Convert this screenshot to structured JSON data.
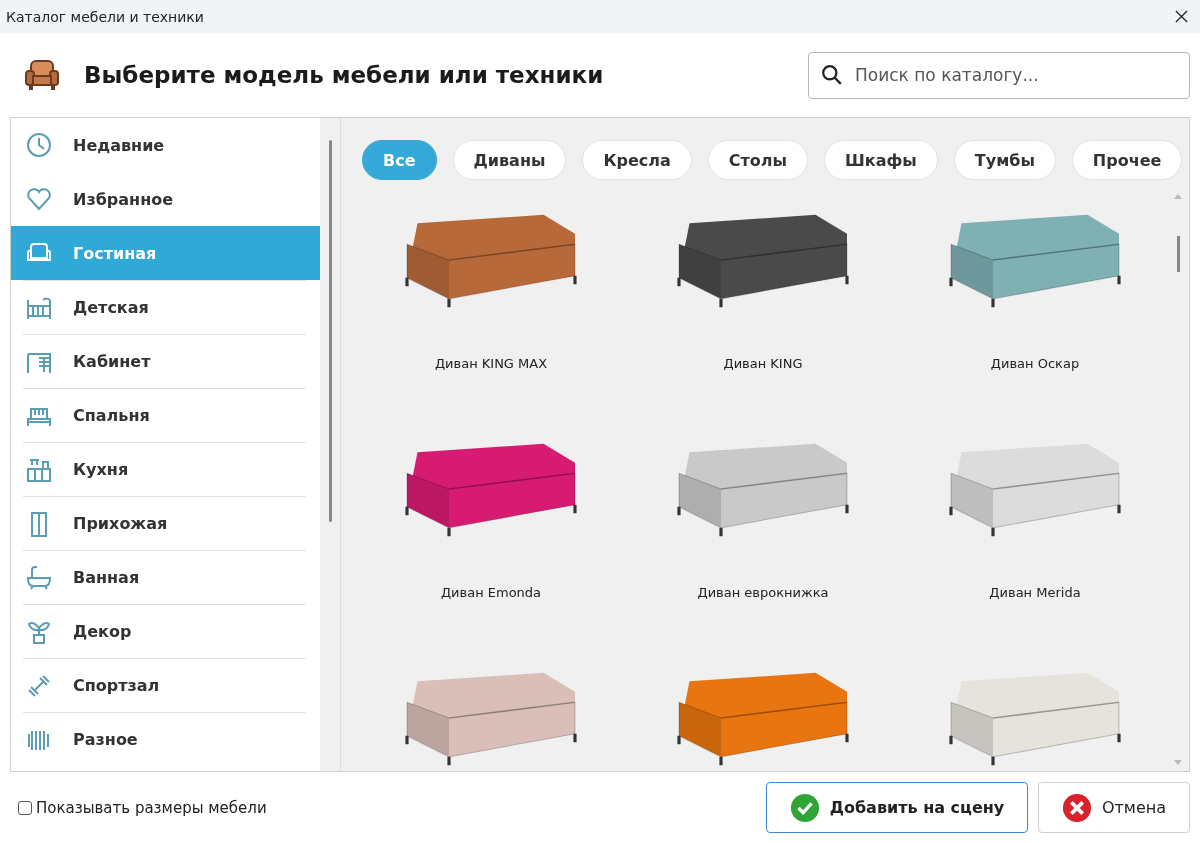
{
  "window": {
    "title": "Каталог мебели и техники"
  },
  "header": {
    "title": "Выберите модель мебели или техники",
    "search": {
      "placeholder": "Поиск по каталогу..."
    }
  },
  "sidebar": {
    "items": [
      {
        "label": "Недавние",
        "selected": false
      },
      {
        "label": "Избранное",
        "selected": false
      },
      {
        "label": "Гостиная",
        "selected": true
      },
      {
        "label": "Детская",
        "selected": false
      },
      {
        "label": "Кабинет",
        "selected": false
      },
      {
        "label": "Спальня",
        "selected": false
      },
      {
        "label": "Кухня",
        "selected": false
      },
      {
        "label": "Прихожая",
        "selected": false
      },
      {
        "label": "Ванная",
        "selected": false
      },
      {
        "label": "Декор",
        "selected": false
      },
      {
        "label": "Спортзал",
        "selected": false
      },
      {
        "label": "Разное",
        "selected": false
      }
    ]
  },
  "filters": [
    {
      "label": "Все",
      "selected": true
    },
    {
      "label": "Диваны",
      "selected": false
    },
    {
      "label": "Кресла",
      "selected": false
    },
    {
      "label": "Столы",
      "selected": false
    },
    {
      "label": "Шкафы",
      "selected": false
    },
    {
      "label": "Тумбы",
      "selected": false
    },
    {
      "label": "Прочее",
      "selected": false
    }
  ],
  "products": [
    {
      "name": "Диван KING MAX",
      "color": "#b8693a"
    },
    {
      "name": "Диван KING",
      "color": "#4a4a4a"
    },
    {
      "name": "Диван Оскар",
      "color": "#7fb0b3"
    },
    {
      "name": "Диван Emonda",
      "color": "#d81b72"
    },
    {
      "name": "Диван еврокнижка",
      "color": "#c9c9c9"
    },
    {
      "name": "Диван Merida",
      "color": "#dcdcdc"
    },
    {
      "color": "#d9bfb8"
    },
    {
      "color": "#e87510"
    },
    {
      "color": "#e6e2dc"
    }
  ],
  "footer": {
    "show_dimensions": {
      "label": "Показывать размеры мебели",
      "checked": false
    },
    "buttons": [
      {
        "label": "Добавить на сцену",
        "kind": "ok"
      },
      {
        "label": "Отмена",
        "kind": "cancel"
      }
    ]
  }
}
